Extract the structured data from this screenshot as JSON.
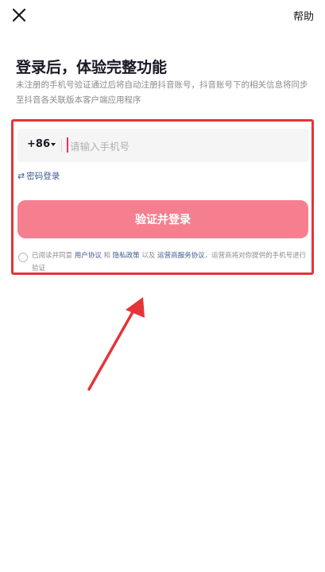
{
  "header": {
    "close_icon": "close-icon",
    "help_label": "帮助"
  },
  "main": {
    "title": "登录后，体验完整功能",
    "subtitle": "未注册的手机号验证通过后将自动注册抖音账号，抖音账号下的相关信息将同步至抖音各关联版本客户端应用程序"
  },
  "form": {
    "country_code": "+86",
    "phone_placeholder": "请输入手机号",
    "phone_value": "",
    "password_login_icon": "swap-arrows-icon",
    "password_login_label": "密码登录",
    "submit_label": "验证并登录"
  },
  "agreement": {
    "prefix": "已阅读并同意",
    "user_agreement": "用户协议",
    "and": "和",
    "privacy_policy": "隐私政策",
    "and_also": "以及",
    "carrier_agreement": "运营商服务协议",
    "suffix": "，运营商将对你提供的手机号进行验证"
  },
  "colors": {
    "highlight_border": "#e53438",
    "button_bg": "#f57f8f",
    "link": "#3c5a8e",
    "annotation_arrow": "#e53438"
  }
}
